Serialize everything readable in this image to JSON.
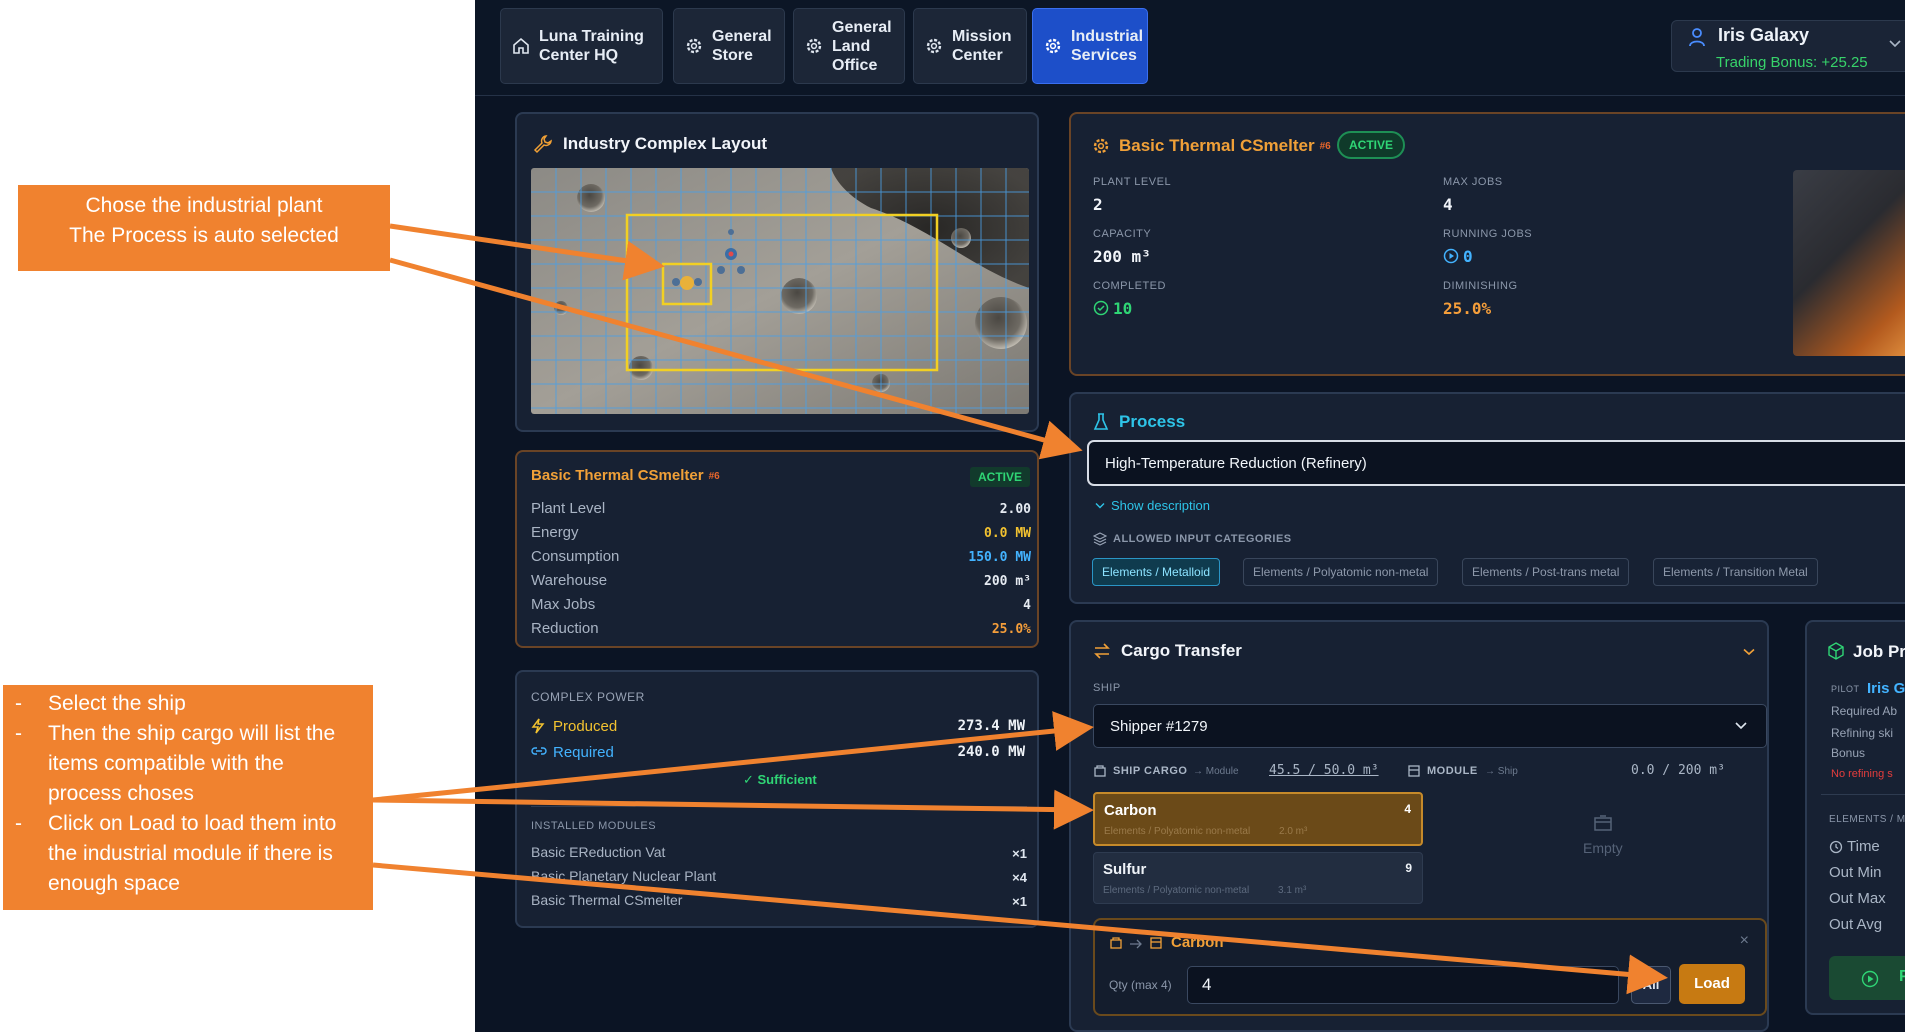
{
  "nav": {
    "tabs": [
      {
        "label": "Luna Training Center HQ",
        "icon": "home-icon",
        "active": false
      },
      {
        "label": "General Store",
        "icon": "gear-icon",
        "active": false
      },
      {
        "label": "General Land Office",
        "icon": "gear-icon",
        "active": false
      },
      {
        "label": "Mission Center",
        "icon": "gear-icon",
        "active": false
      },
      {
        "label": "Industrial Services",
        "icon": "gear-icon",
        "active": true
      }
    ],
    "user": {
      "name": "Iris Galaxy",
      "bonus": "Trading Bonus: +25.25",
      "icon": "user-icon"
    }
  },
  "layout_panel": {
    "title": "Industry Complex Layout",
    "icon": "wrench-icon"
  },
  "plant_summary": {
    "name": "Basic Thermal CSmelter",
    "tag": "#6",
    "status": "ACTIVE",
    "rows": [
      {
        "label": "Plant Level",
        "value": "2.00",
        "color": "#e6ebf2"
      },
      {
        "label": "Energy",
        "value": "0.0 MW",
        "color": "#f2c230"
      },
      {
        "label": "Consumption",
        "value": "150.0 MW",
        "color": "#43b3ff"
      },
      {
        "label": "Warehouse",
        "value": "200 m³",
        "color": "#e6ebf2"
      },
      {
        "label": "Max Jobs",
        "value": "4",
        "color": "#e6ebf2"
      },
      {
        "label": "Reduction",
        "value": "25.0%",
        "color": "#f59e3a"
      }
    ]
  },
  "power": {
    "title": "COMPLEX POWER",
    "produced_label": "Produced",
    "produced_value": "273.4 MW",
    "required_label": "Required",
    "required_value": "240.0 MW",
    "status": "✓ Sufficient",
    "modules_title": "INSTALLED MODULES",
    "modules": [
      {
        "name": "Basic EReduction Vat",
        "count": "×1"
      },
      {
        "name": "Basic Planetary Nuclear Plant",
        "count": "×4"
      },
      {
        "name": "Basic Thermal CSmelter",
        "count": "×1"
      }
    ]
  },
  "plant_detail": {
    "name": "Basic Thermal CSmelter",
    "tag": "#6",
    "status": "ACTIVE",
    "plant_level_label": "PLANT LEVEL",
    "plant_level": "2",
    "max_jobs_label": "MAX JOBS",
    "max_jobs": "4",
    "capacity_label": "CAPACITY",
    "capacity": "200 m³",
    "running_jobs_label": "RUNNING JOBS",
    "running_jobs": "0",
    "completed_label": "COMPLETED",
    "completed": "10",
    "diminishing_label": "DIMINISHING",
    "diminishing": "25.0%"
  },
  "process": {
    "title": "Process",
    "selected": "High-Temperature Reduction (Refinery)",
    "show_description": "Show description",
    "allowed_label": "ALLOWED INPUT CATEGORIES",
    "categories": [
      {
        "label": "Elements / Metalloid",
        "selected": true
      },
      {
        "label": "Elements / Polyatomic non-metal",
        "selected": false
      },
      {
        "label": "Elements / Post-trans metal",
        "selected": false
      },
      {
        "label": "Elements / Transition Metal",
        "selected": false
      }
    ]
  },
  "cargo": {
    "title": "Cargo Transfer",
    "ship_label": "SHIP",
    "ship_value": "Shipper #1279",
    "ship_cargo_label": "SHIP CARGO",
    "ship_cargo_sub": "→ Module",
    "ship_cargo_capacity": "45.5 / 50.0 m³",
    "module_label": "MODULE",
    "module_sub": "→ Ship",
    "module_capacity": "0.0 / 200 m³",
    "empty_label": "Empty",
    "items": [
      {
        "name": "Carbon",
        "qty": "4",
        "sub": "Elements / Polyatomic non-metal",
        "vol": "2.0 m³",
        "selected": true
      },
      {
        "name": "Sulfur",
        "qty": "9",
        "sub": "Elements / Polyatomic non-metal",
        "vol": "3.1 m³",
        "selected": false
      }
    ],
    "transfer_item": "Carbon",
    "qty_label": "Qty (max 4)",
    "qty_value": "4",
    "all_label": "All",
    "load_label": "Load"
  },
  "job_panel": {
    "title": "Job Pr",
    "pilot_label": "PILOT",
    "pilot_value": "Iris G",
    "lines": [
      "Required Ab",
      "Refining ski",
      "Bonus"
    ],
    "warning": "No refining s",
    "elements_label": "ELEMENTS / M",
    "stats": [
      "Time",
      "Out Min",
      "Out Max",
      "Out Avg"
    ],
    "button_label": "P"
  },
  "annotations": {
    "top": [
      "Chose the industrial plant",
      "The Process is auto selected"
    ],
    "bottom": [
      "Select the ship",
      "Then the ship cargo will list the items compatible with the process choses",
      "Click on Load to load them into the industrial module if there is enough space"
    ]
  },
  "colors": {
    "accent_orange": "#f0822f",
    "active_tab": "#1d4fc9",
    "success": "#2fd575",
    "gold": "#f2a935"
  }
}
